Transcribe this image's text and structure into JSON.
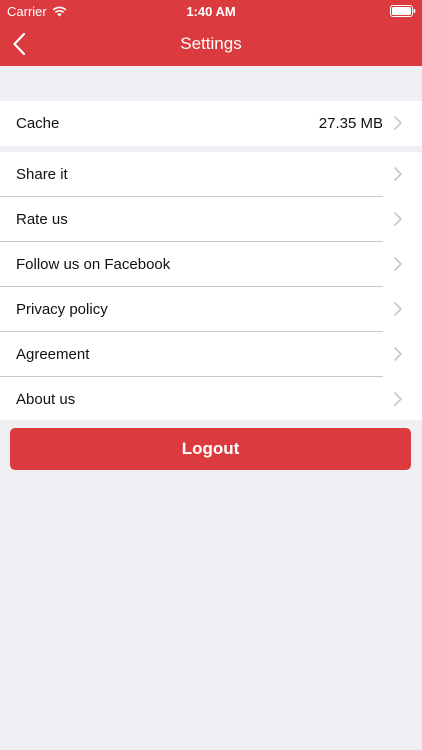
{
  "status_bar": {
    "carrier": "Carrier",
    "time": "1:40 AM",
    "icons": [
      "wifi-icon",
      "battery-icon"
    ]
  },
  "nav": {
    "title": "Settings",
    "back_icon": "chevron-left-icon"
  },
  "cache": {
    "label": "Cache",
    "value": "27.35 MB"
  },
  "menu": [
    {
      "label": "Share it"
    },
    {
      "label": "Rate us"
    },
    {
      "label": "Follow us on Facebook"
    },
    {
      "label": "Privacy policy"
    },
    {
      "label": "Agreement"
    },
    {
      "label": "About us"
    }
  ],
  "logout_label": "Logout",
  "colors": {
    "accent": "#db3b3f",
    "background": "#efeff4",
    "separator": "#c8c7cc",
    "chevron": "#c7c7cc"
  }
}
